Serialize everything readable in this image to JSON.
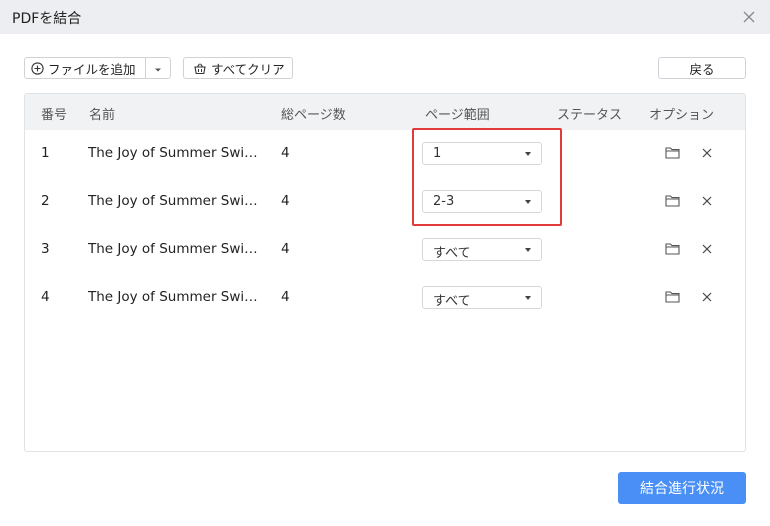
{
  "window": {
    "title": "PDFを結合"
  },
  "toolbar": {
    "add_file_label": "ファイルを追加",
    "clear_all_label": "すべてクリア",
    "back_label": "戻る"
  },
  "table": {
    "headers": {
      "number": "番号",
      "name": "名前",
      "total_pages": "総ページ数",
      "page_range": "ページ範囲",
      "status": "ステータス",
      "options": "オプション"
    },
    "rows": [
      {
        "number": "1",
        "name": "The Joy of Summer Swimm...",
        "total_pages": "4",
        "page_range": "1",
        "status": ""
      },
      {
        "number": "2",
        "name": "The Joy of Summer Swimm...",
        "total_pages": "4",
        "page_range": "2-3",
        "status": ""
      },
      {
        "number": "3",
        "name": "The Joy of Summer Swimm...",
        "total_pages": "4",
        "page_range": "すべて",
        "status": ""
      },
      {
        "number": "4",
        "name": "The Joy of Summer Swimm...",
        "total_pages": "4",
        "page_range": "すべて",
        "status": ""
      }
    ]
  },
  "footer": {
    "merge_label": "結合進行状況"
  },
  "colors": {
    "primary": "#4a8ff5",
    "highlight": "#e23b3b",
    "titlebar": "#eceef1",
    "header_bg": "#f1f2f4"
  },
  "icons": {
    "close": "close-icon",
    "add": "plus-circle-icon",
    "dropdown": "chevron-down-icon",
    "clear": "basket-icon",
    "folder": "folder-icon",
    "remove": "close-icon"
  }
}
